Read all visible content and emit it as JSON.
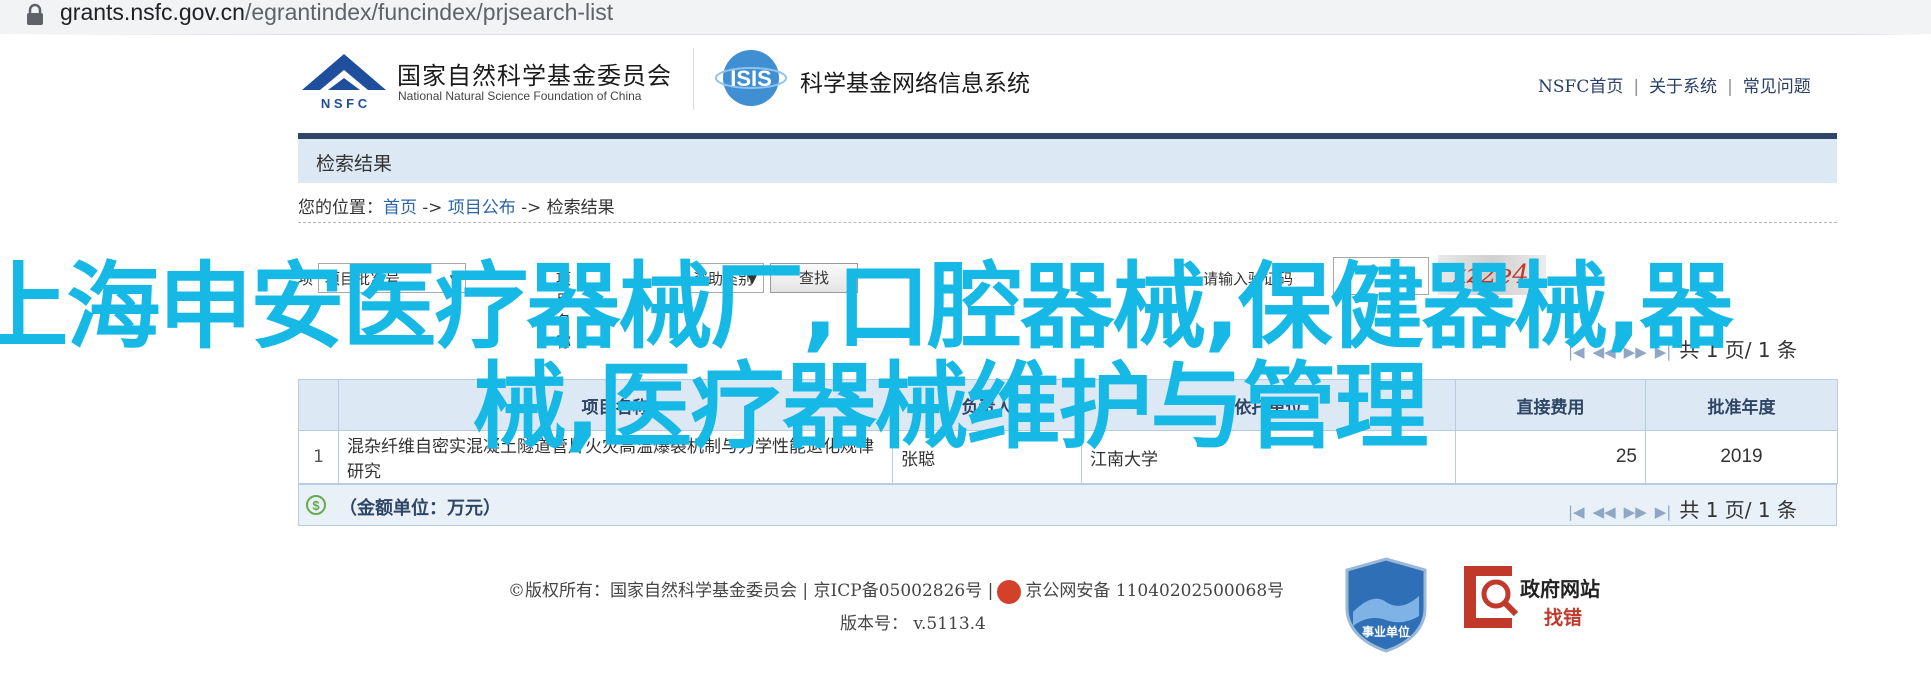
{
  "browser": {
    "url_host": "grants.nsfc.gov.cn",
    "url_path": "/egrantindex/funcindex/prjsearch-list"
  },
  "header": {
    "org_cn": "国家自然科学基金委员会",
    "org_en": "National Natural Science Foundation of China",
    "logo_text": "N S F C",
    "isis_text": "ISIS",
    "system_title": "科学基金网络信息系统",
    "nav": [
      "NSFC首页",
      "关于系统",
      "常见问题"
    ]
  },
  "results": {
    "title": "检索结果"
  },
  "breadcrumb": {
    "prefix": "您的位置：",
    "items": [
      "首页",
      "项目公布",
      "检索结果"
    ],
    "sep": " -> "
  },
  "search_form": {
    "label_start": "项",
    "select1": "项目批准号",
    "label2": "项目名称",
    "select2": "资助类别",
    "search_button": "查找",
    "verify_label": "请输入验证码",
    "captcha_text": "xz2e4"
  },
  "pager": {
    "total_label": "共 1 页/ 1 条"
  },
  "table": {
    "headers": [
      "",
      "项目名称",
      "负责人",
      "依托单位",
      "直接费用",
      "批准年度"
    ],
    "rows": [
      {
        "idx": "1",
        "title": "混杂纤维自密实混凝土隧道管片火灾高温爆裂机制与力学性能退化规律研究",
        "leader": "张聪",
        "org": "江南大学",
        "cost": "25",
        "year": "2019"
      }
    ]
  },
  "footer_bar": {
    "unit_label": "（金额单位：万元）"
  },
  "footer": {
    "copyright": "©版权所有：国家自然科学基金委员会 | 京ICP备05002826号 |",
    "police": "京公网安备 11040202500068号",
    "version": "版本号： v.5113.4",
    "shield_text": "事业单位",
    "gov_title": "政府网站",
    "gov_sub": "找错"
  },
  "overlay": {
    "line1": "上海申安医疗器械厂,口腔器械,保健器械,器",
    "line2": "械,医疗器械维护与管理"
  }
}
